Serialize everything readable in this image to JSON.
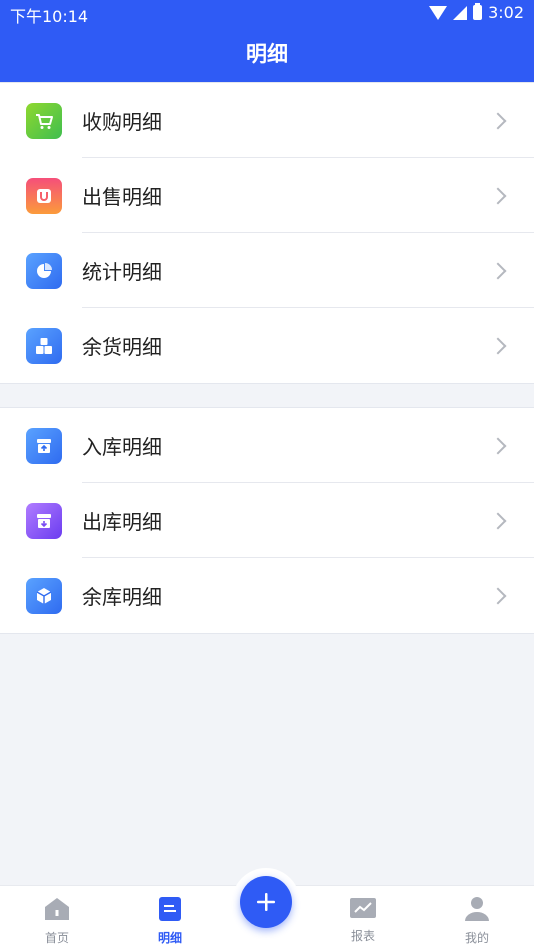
{
  "status_bar": {
    "time": "下午10:14",
    "battery": "3:02"
  },
  "header": {
    "title": "明细"
  },
  "groups": [
    {
      "items": [
        {
          "label": "收购明细",
          "icon": "cart-icon",
          "color": "#5cc639"
        },
        {
          "label": "出售明细",
          "icon": "u-bag-icon",
          "color": "#f86b5f"
        },
        {
          "label": "统计明细",
          "icon": "pie-chart-icon",
          "color": "#3f82f4"
        },
        {
          "label": "余货明细",
          "icon": "boxes-icon",
          "color": "#3f82f4"
        }
      ]
    },
    {
      "items": [
        {
          "label": "入库明细",
          "icon": "inbox-in-icon",
          "color": "#3f82f4"
        },
        {
          "label": "出库明细",
          "icon": "inbox-out-icon",
          "color": "#8b5cf0"
        },
        {
          "label": "余库明细",
          "icon": "cube-icon",
          "color": "#3f82f4"
        }
      ]
    }
  ],
  "tabbar": {
    "tabs": [
      {
        "label": "首页",
        "icon": "home-icon"
      },
      {
        "label": "明细",
        "icon": "document-icon",
        "active": true
      },
      {
        "label": "报表",
        "icon": "chart-icon"
      },
      {
        "label": "我的",
        "icon": "user-icon"
      }
    ],
    "fab_icon": "plus-icon"
  },
  "colors": {
    "primary": "#2f5bf5",
    "background": "#f2f4f8"
  }
}
